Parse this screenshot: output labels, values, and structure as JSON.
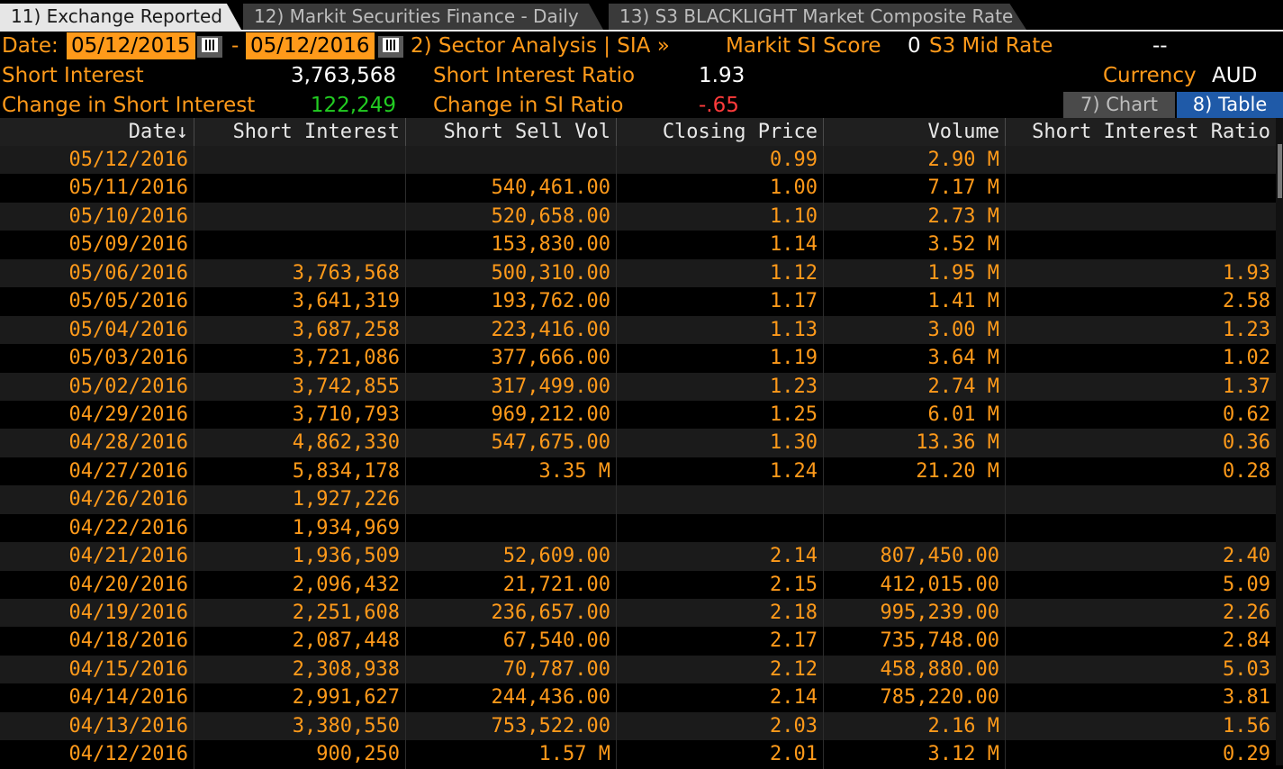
{
  "tabs": [
    {
      "label": "11) Exchange Reported"
    },
    {
      "label": "12) Markit Securities Finance - Daily"
    },
    {
      "label": "13) S3 BLACKLIGHT Market Composite Rate"
    }
  ],
  "header": {
    "date_label": "Date:",
    "date_start": "05/12/2015",
    "date_sep": "-",
    "date_end": "05/12/2016",
    "sector_link": "2) Sector Analysis | SIA »",
    "markit_label": "Markit SI Score",
    "markit_value": "0",
    "s3_label": "S3 Mid Rate",
    "s3_value": "--",
    "short_interest_label": "Short Interest",
    "short_interest_value": "3,763,568",
    "si_ratio_label": "Short Interest Ratio",
    "si_ratio_value": "1.93",
    "currency_label": "Currency",
    "currency_value": "AUD",
    "change_si_label": "Change in Short Interest",
    "change_si_value": "122,249",
    "change_ratio_label": "Change in SI Ratio",
    "change_ratio_value": "-.65",
    "chart_button": "7) Chart",
    "table_button": "8) Table"
  },
  "table": {
    "columns": [
      "Date↓",
      "Short Interest",
      "Short Sell Vol",
      "Closing Price",
      "Volume",
      "Short Interest Ratio"
    ],
    "rows": [
      [
        "05/12/2016",
        "",
        "",
        "0.99",
        "2.90 M",
        ""
      ],
      [
        "05/11/2016",
        "",
        "540,461.00",
        "1.00",
        "7.17 M",
        ""
      ],
      [
        "05/10/2016",
        "",
        "520,658.00",
        "1.10",
        "2.73 M",
        ""
      ],
      [
        "05/09/2016",
        "",
        "153,830.00",
        "1.14",
        "3.52 M",
        ""
      ],
      [
        "05/06/2016",
        "3,763,568",
        "500,310.00",
        "1.12",
        "1.95 M",
        "1.93"
      ],
      [
        "05/05/2016",
        "3,641,319",
        "193,762.00",
        "1.17",
        "1.41 M",
        "2.58"
      ],
      [
        "05/04/2016",
        "3,687,258",
        "223,416.00",
        "1.13",
        "3.00 M",
        "1.23"
      ],
      [
        "05/03/2016",
        "3,721,086",
        "377,666.00",
        "1.19",
        "3.64 M",
        "1.02"
      ],
      [
        "05/02/2016",
        "3,742,855",
        "317,499.00",
        "1.23",
        "2.74 M",
        "1.37"
      ],
      [
        "04/29/2016",
        "3,710,793",
        "969,212.00",
        "1.25",
        "6.01 M",
        "0.62"
      ],
      [
        "04/28/2016",
        "4,862,330",
        "547,675.00",
        "1.30",
        "13.36 M",
        "0.36"
      ],
      [
        "04/27/2016",
        "5,834,178",
        "3.35 M",
        "1.24",
        "21.20 M",
        "0.28"
      ],
      [
        "04/26/2016",
        "1,927,226",
        "",
        "",
        "",
        ""
      ],
      [
        "04/22/2016",
        "1,934,969",
        "",
        "",
        "",
        ""
      ],
      [
        "04/21/2016",
        "1,936,509",
        "52,609.00",
        "2.14",
        "807,450.00",
        "2.40"
      ],
      [
        "04/20/2016",
        "2,096,432",
        "21,721.00",
        "2.15",
        "412,015.00",
        "5.09"
      ],
      [
        "04/19/2016",
        "2,251,608",
        "236,657.00",
        "2.18",
        "995,239.00",
        "2.26"
      ],
      [
        "04/18/2016",
        "2,087,448",
        "67,540.00",
        "2.17",
        "735,748.00",
        "2.84"
      ],
      [
        "04/15/2016",
        "2,308,938",
        "70,787.00",
        "2.12",
        "458,880.00",
        "5.03"
      ],
      [
        "04/14/2016",
        "2,991,627",
        "244,436.00",
        "2.14",
        "785,220.00",
        "3.81"
      ],
      [
        "04/13/2016",
        "3,380,550",
        "753,522.00",
        "2.03",
        "2.16 M",
        "1.56"
      ],
      [
        "04/12/2016",
        "900,250",
        "1.57 M",
        "2.01",
        "3.12 M",
        "0.29"
      ]
    ]
  },
  "colors": {
    "accent": "#ff9a1a",
    "positive": "#22cc22",
    "negative": "#ff3b3b",
    "active_toggle": "#1f5aa8"
  }
}
